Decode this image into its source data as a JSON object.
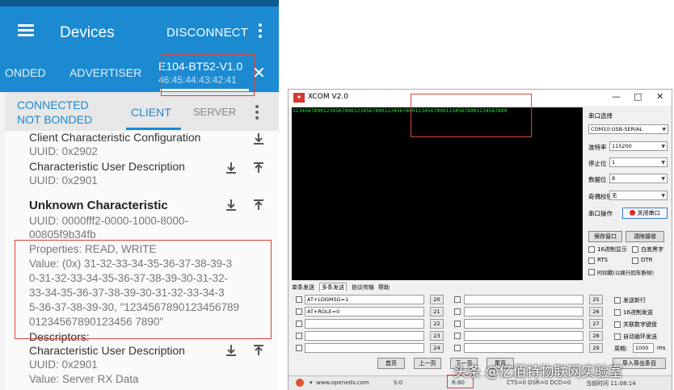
{
  "phone": {
    "appbar": {
      "title": "Devices",
      "disconnect": "DISCONNECT"
    },
    "tabs": {
      "bonded": "ONDED",
      "advertiser": "ADVERTISER",
      "device_name": "E104-BT52-V1.0",
      "device_mac": "46:45:44:43:42:41",
      "close": "✕"
    },
    "connection": {
      "connected": "CONNECTED",
      "not_bonded": "NOT BONDED",
      "client": "CLIENT",
      "server": "SERVER"
    },
    "attributes": {
      "cccd_title": "Client Characteristic Configuration",
      "cccd_uuid": "UUID: 0x2902",
      "cud1_title": "Characteristic User Description",
      "cud1_uuid": "UUID: 0x2901",
      "unknown_title": "Unknown Characteristic",
      "unknown_uuid_1": "UUID: 0000fff2-0000-1000-8000-",
      "unknown_uuid_2": "00805f9b34fb",
      "properties": "Properties: READ, WRITE",
      "value_lines": [
        "Value: (0x) 31-32-33-34-35-36-37-38-39-3",
        "0-31-32-33-34-35-36-37-38-39-30-31-32-",
        "33-34-35-36-37-38-39-30-31-32-33-34-3",
        "5-36-37-38-39-30, \"1234567890123456789",
        "01234567890123456 7890\""
      ],
      "descriptors": "Descriptors:",
      "cud2_title": "Characteristic User Description",
      "cud2_uuid": "UUID: 0x2901",
      "cud2_value": "Value: Server RX Data"
    }
  },
  "xcom": {
    "title": "XCOM V2.0",
    "window_buttons": {
      "minimize": "—",
      "maximize": "□",
      "close": "✕"
    },
    "rx_text": "1234567890123456789012345678901234567890123456789012345678901234567890",
    "side": {
      "port_label": "串口选择",
      "port_value": "COM10:USB-SERIAL",
      "baud_label": "波特率",
      "baud_value": "115200",
      "stop_label": "停止位",
      "stop_value": "1",
      "data_label": "数据位",
      "data_value": "8",
      "parity_label": "奇偶校验",
      "parity_value": "无",
      "op_label": "串口操作",
      "op_button": "关闭串口",
      "save_window": "保存窗口",
      "clear_rx": "清除接收",
      "hex_display": "16进制显示",
      "white_black": "白底黑字",
      "rts": "RTS",
      "dtr": "DTR",
      "timestamp": "时间戳(以换行回车断帧)"
    },
    "tabs": [
      "单条发送",
      "多条发送",
      "协议传输",
      "帮助"
    ],
    "rows_left": [
      {
        "cmd": "AT+LOGMSG=1",
        "num": "20"
      },
      {
        "cmd": "AT+ROLE=0",
        "num": "21"
      },
      {
        "cmd": "",
        "num": "22"
      },
      {
        "cmd": "",
        "num": "23"
      },
      {
        "cmd": "",
        "num": "24"
      }
    ],
    "rows_right": [
      {
        "num": "25"
      },
      {
        "num": "26"
      },
      {
        "num": "27"
      },
      {
        "num": "28"
      },
      {
        "num": "29"
      }
    ],
    "options": {
      "send_newline": "发送新行",
      "hex_send": "16进制发送",
      "associate_numpad": "关联数字键盘",
      "auto_loop": "自动循环发送",
      "period_label": "周期:",
      "period_value": "1000",
      "period_unit": "ms",
      "import_export": "导入导出条目"
    },
    "paging": {
      "first": "首页",
      "prev": "上一页",
      "next": "下一页",
      "last": "尾页"
    },
    "status": {
      "url": "www.openedv.com",
      "s": "S:0",
      "r": "R:80",
      "lines": "CTS=0 DSR=0 DCD=0",
      "time": "当前时间 11:08:14"
    }
  },
  "watermark": "头条 @亿佰特物联网实验室"
}
